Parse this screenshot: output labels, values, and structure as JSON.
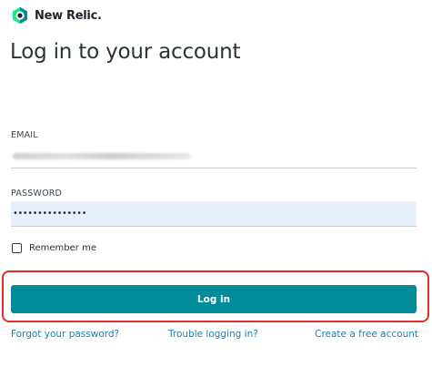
{
  "brand": {
    "name": "New Relic.",
    "logo_icon": "new-relic-logo-icon",
    "accent_color": "#008c99"
  },
  "page": {
    "title": "Log in to your account"
  },
  "form": {
    "email": {
      "label": "EMAIL",
      "value_obscured": true
    },
    "password": {
      "label": "PASSWORD",
      "value": "•••••••••••••••"
    },
    "remember": {
      "label": "Remember me",
      "checked": false
    },
    "submit_label": "Log in"
  },
  "highlight": {
    "color": "#e22d2d"
  },
  "links": {
    "forgot": "Forgot your password?",
    "trouble": "Trouble logging in?",
    "create": "Create a free account"
  }
}
